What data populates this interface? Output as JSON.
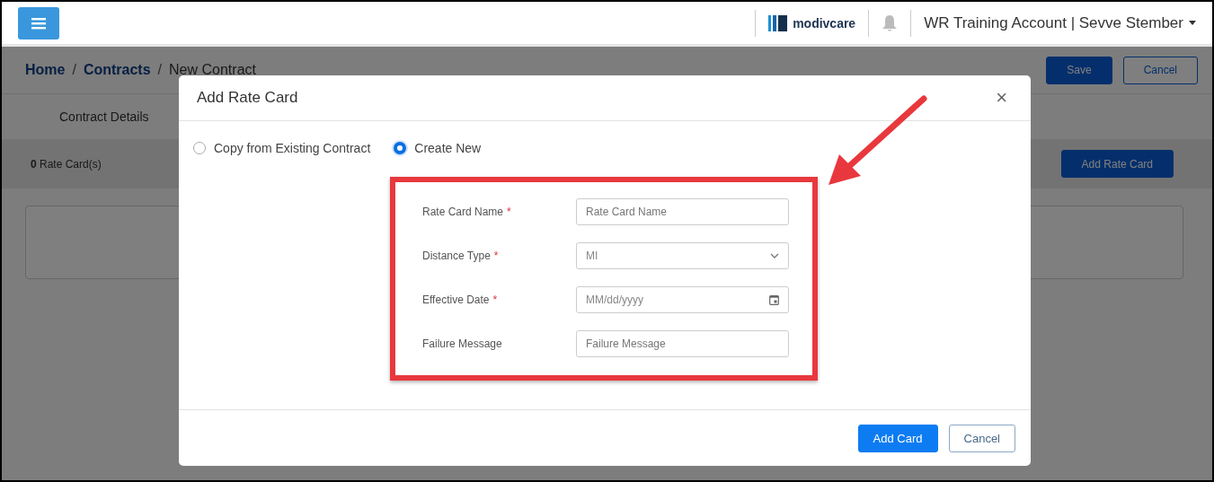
{
  "header": {
    "logo_text": "modivcare",
    "account": "WR Training Account | Sevve Stember"
  },
  "breadcrumb": [
    {
      "label": "Home",
      "kind": "link"
    },
    {
      "separator": "/",
      "label": "Contracts",
      "kind": "link"
    },
    {
      "separator": "/",
      "label": "New Contract",
      "kind": "current"
    }
  ],
  "actions": [
    {
      "label": "Save",
      "kind": "primary"
    },
    {
      "label": "Cancel",
      "kind": "secondary"
    }
  ],
  "section_tab": "Contract Details",
  "rate_cards": {
    "count": "0",
    "label": "Rate Card(s)",
    "add_button": "Add Rate Card"
  },
  "modal": {
    "title": "Add Rate Card",
    "close": "×",
    "options": [
      {
        "label": "Copy from Existing Contract",
        "selected": false
      },
      {
        "label": "Create New",
        "selected": true
      }
    ],
    "fields": [
      {
        "label": "Rate Card Name",
        "required_mark": "*",
        "kind": "text",
        "placeholder": "Rate Card Name"
      },
      {
        "label": "Distance Type",
        "required_mark": "*",
        "kind": "select",
        "value": "MI"
      },
      {
        "label": "Effective Date",
        "required_mark": "*",
        "kind": "date",
        "placeholder": "MM/dd/yyyy"
      },
      {
        "label": "Failure Message",
        "kind": "text",
        "placeholder": "Failure Message"
      }
    ],
    "buttons": [
      {
        "label": "Add Card",
        "kind": "primary"
      },
      {
        "label": "Cancel",
        "kind": "secondary"
      }
    ]
  }
}
